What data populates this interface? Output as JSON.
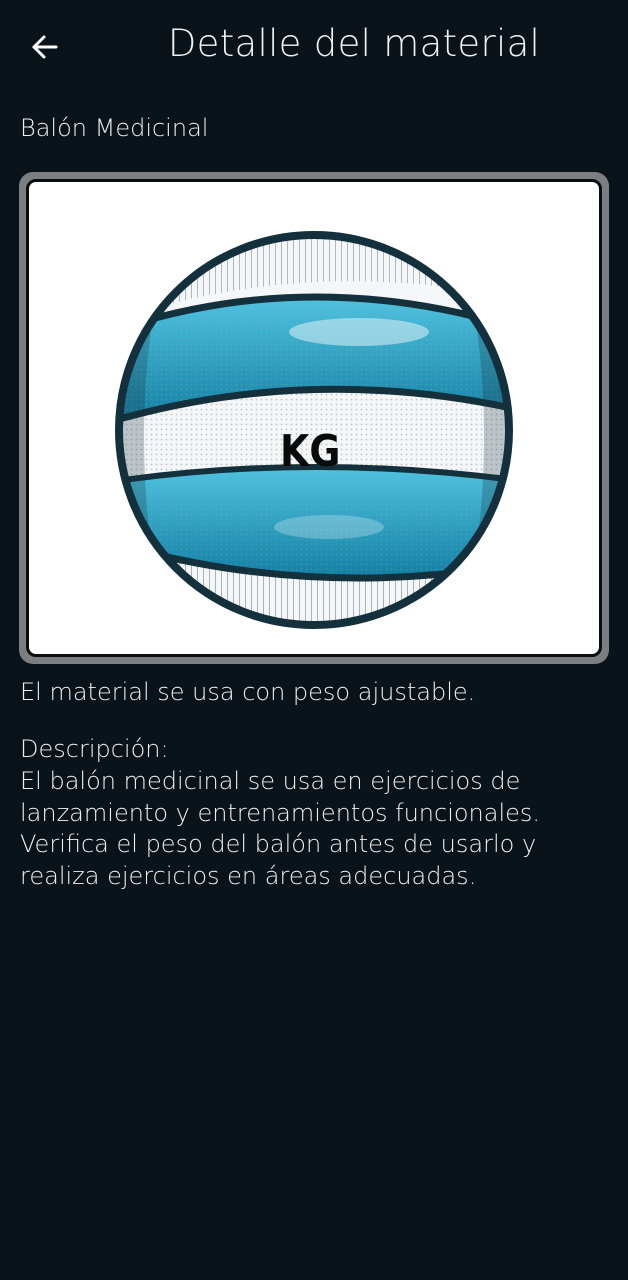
{
  "header": {
    "title": "Detalle del material",
    "back_icon": "arrow-left-icon"
  },
  "material": {
    "name": "Balón Medicinal",
    "image_label": "KG",
    "usage": "El material se usa con peso ajustable.",
    "description_label": "Descripción:",
    "description": "El balón medicinal se usa en ejercicios de lanzamiento y entrenamientos funcionales. Verifica el peso del balón antes de usarlo y realiza ejercicios en áreas adecuadas."
  },
  "colors": {
    "background": "#0b131a",
    "text": "#eef0f2",
    "frame": "#7c7f82",
    "ball_blue": "#1ea7cc",
    "ball_outline": "#14303d"
  }
}
